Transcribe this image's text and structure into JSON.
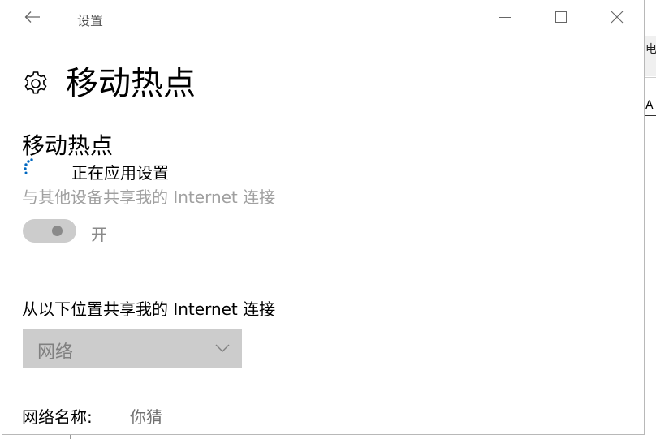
{
  "window": {
    "title": "设置",
    "back_icon": "arrow-left-icon",
    "controls": {
      "minimize_icon": "minimize-icon",
      "maximize_icon": "maximize-icon",
      "close_icon": "close-icon"
    }
  },
  "page": {
    "icon": "gear-icon",
    "title": "移动热点"
  },
  "hotspot": {
    "section_title": "移动热点",
    "status": "正在应用设置",
    "description": "与其他设备共享我的 Internet 连接",
    "toggle_label": "开",
    "toggle_on": true
  },
  "share_from": {
    "label": "从以下位置共享我的 Internet 连接",
    "selected": "网络"
  },
  "network_name": {
    "label": "网络名称:",
    "value": "你猜"
  },
  "background": {
    "fragment1": "电话",
    "fragment2": "A"
  }
}
